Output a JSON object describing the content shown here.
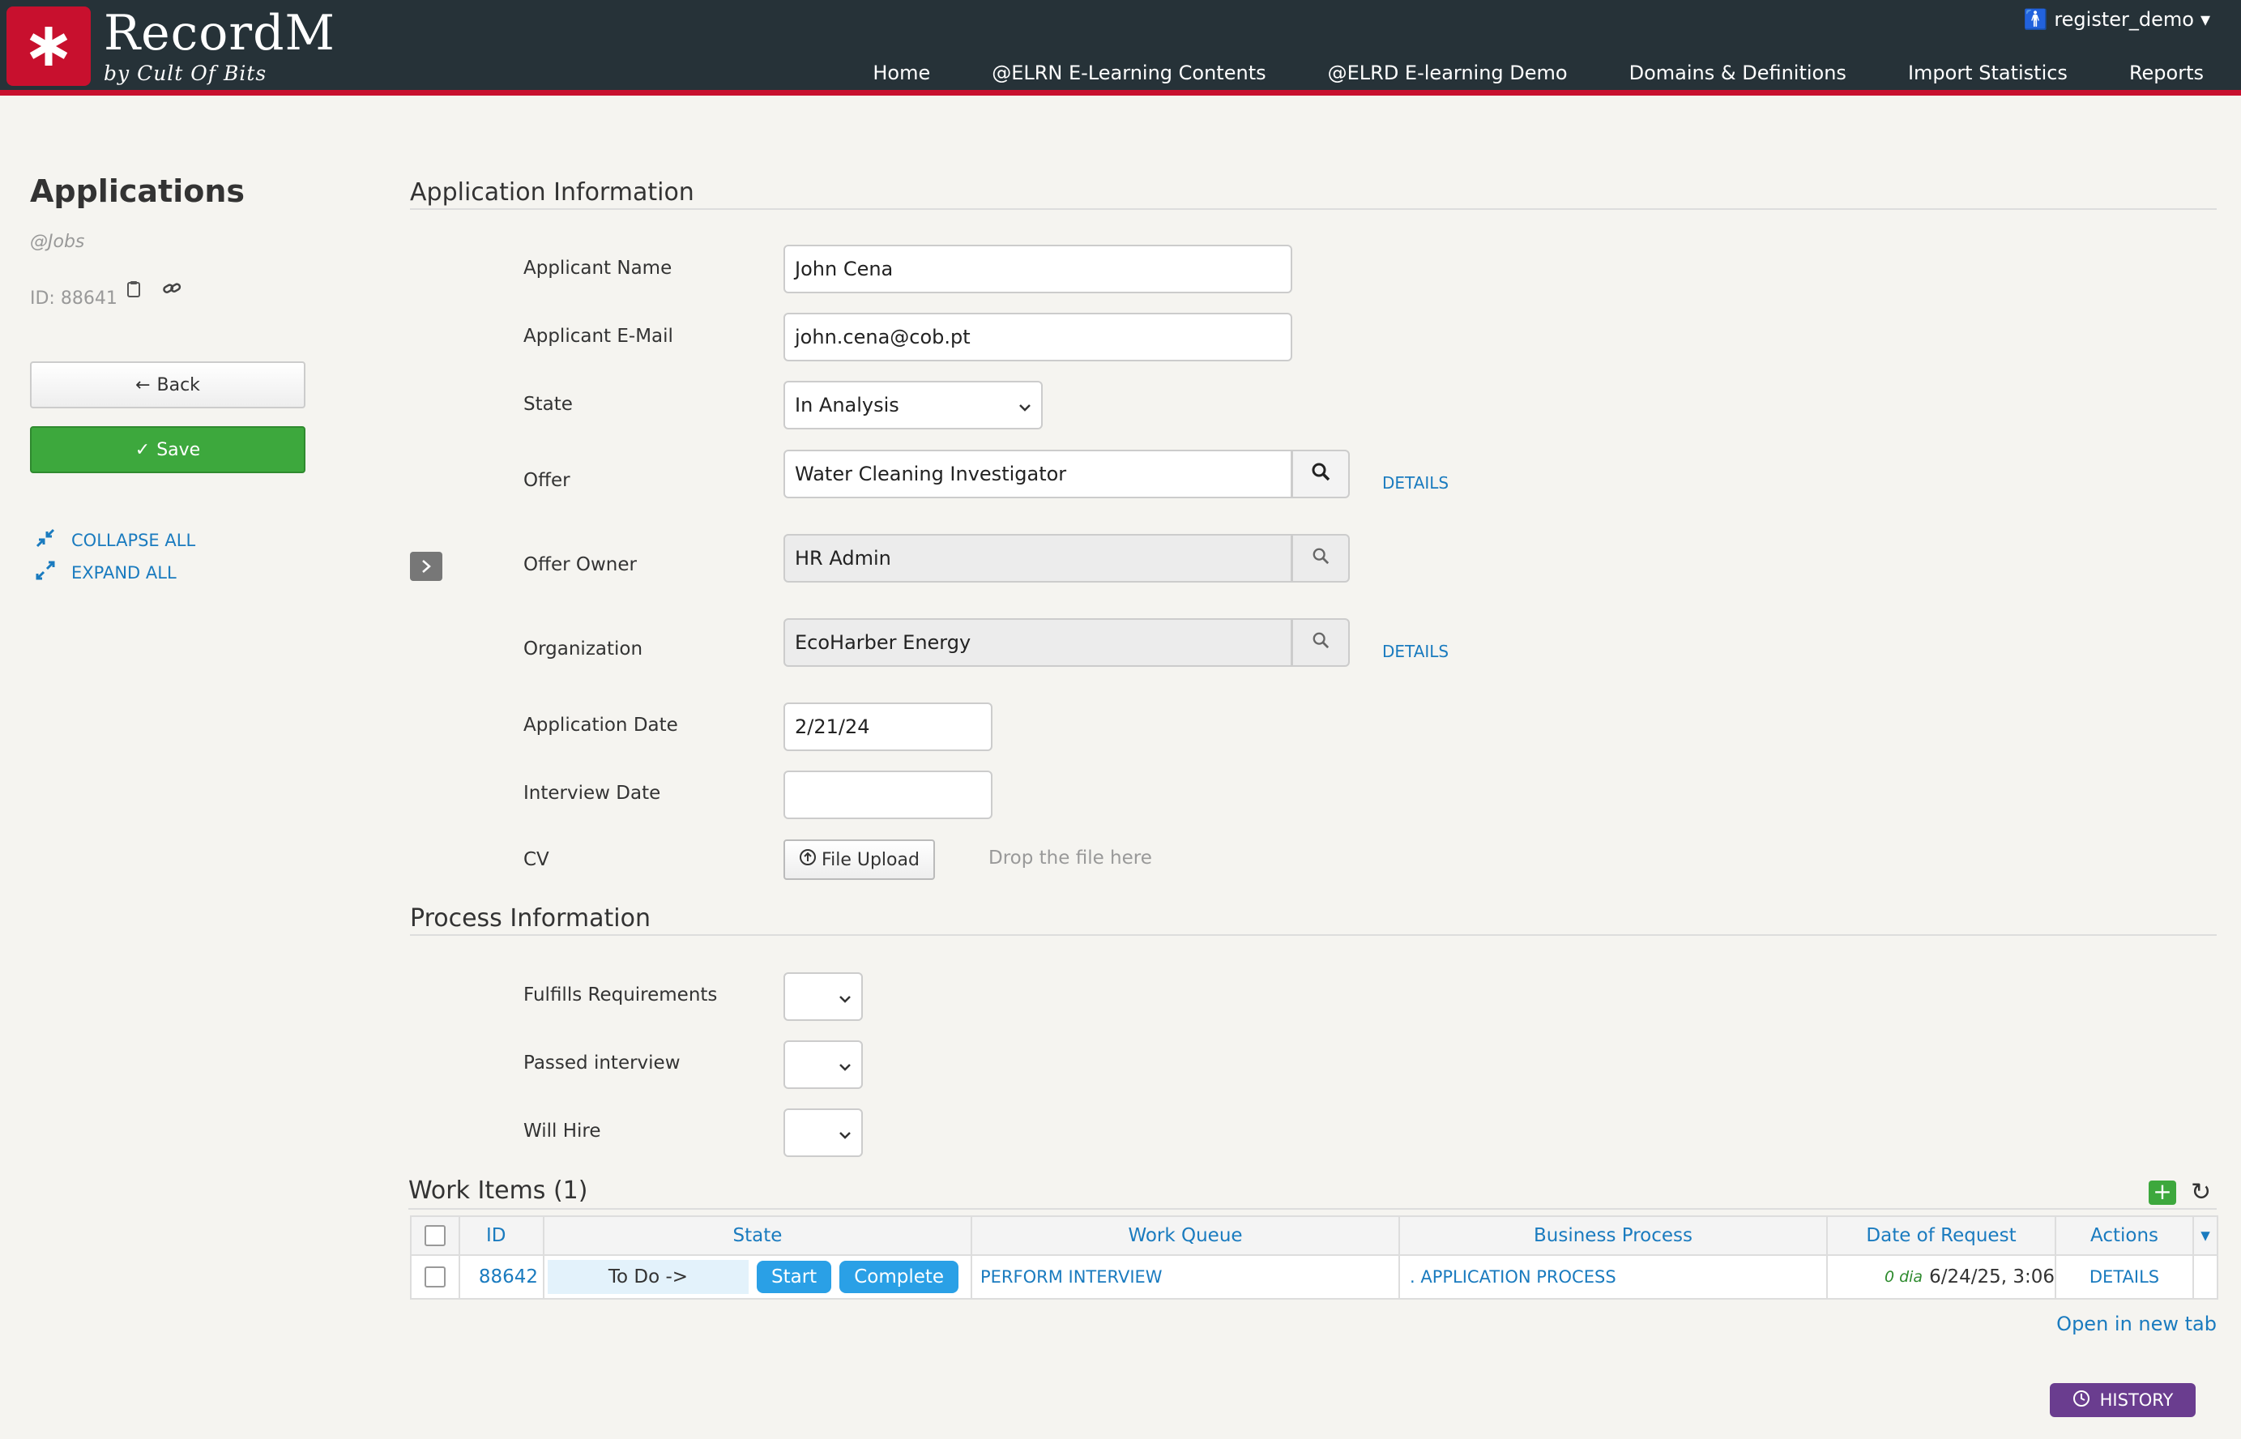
{
  "header": {
    "brand_name": "RecordM",
    "brand_sub": "by Cult Of Bits",
    "user": "register_demo",
    "nav": [
      "Home",
      "@ELRN E-Learning Contents",
      "@ELRD E-learning Demo",
      "Domains & Definitions",
      "Import Statistics",
      "Reports"
    ]
  },
  "sidebar": {
    "title": "Applications",
    "subtitle": "@Jobs",
    "id_label": "ID: 88641",
    "back_label": "Back",
    "save_label": "Save",
    "collapse_label": "COLLAPSE ALL",
    "expand_label": "EXPAND ALL"
  },
  "application_info": {
    "title": "Application Information",
    "name_label": "Applicant Name",
    "name_value": "John Cena",
    "email_label": "Applicant E-Mail",
    "email_value": "john.cena@cob.pt",
    "state_label": "State",
    "state_value": "In Analysis",
    "offer_label": "Offer",
    "offer_value": "Water Cleaning Investigator",
    "offer_details": "DETAILS",
    "owner_label": "Offer Owner",
    "owner_value": "HR Admin",
    "org_label": "Organization",
    "org_value": "EcoHarber Energy",
    "org_details": "DETAILS",
    "app_date_label": "Application Date",
    "app_date_value": "2/21/24",
    "interview_label": "Interview Date",
    "interview_value": "",
    "cv_label": "CV",
    "upload_label": "File Upload",
    "drop_text": "Drop the file here"
  },
  "process_info": {
    "title": "Process Information",
    "fulfills_label": "Fulfills Requirements",
    "passed_label": "Passed interview",
    "hire_label": "Will Hire"
  },
  "work_items": {
    "title": "Work Items (1)",
    "columns": [
      "ID",
      "State",
      "Work Queue",
      "Business Process",
      "Date of Request",
      "Actions"
    ],
    "rows": [
      {
        "id": "88642",
        "state": "To Do ->",
        "start": "Start",
        "complete": "Complete",
        "work_queue": "PERFORM INTERVIEW",
        "business_process": ". APPLICATION PROCESS",
        "age": "0 dia",
        "date": "6/24/25, 3:06",
        "action": "DETAILS"
      }
    ],
    "open_new_tab": "Open in new tab"
  },
  "history_label": "HISTORY",
  "colors": {
    "header_bg": "#263238",
    "brand_red": "#c8102e",
    "save_green": "#3da83d",
    "link_blue": "#1a7bbf",
    "pill_blue": "#2aa0e6",
    "history_purple": "#6a3d8f"
  }
}
